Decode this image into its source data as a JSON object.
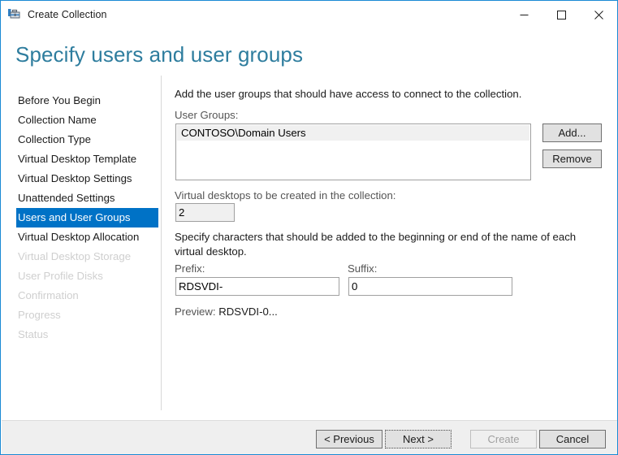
{
  "window": {
    "title": "Create Collection",
    "icon": "collection-toolbox-icon",
    "controls": {
      "minimize": "minimize-icon",
      "maximize": "maximize-icon",
      "close": "close-icon"
    },
    "accent_border": "#1a8ad4"
  },
  "header": {
    "page_title": "Specify users and user groups",
    "title_color": "#2e7d9e"
  },
  "sidebar": {
    "selected_color": "#0072c6",
    "items": [
      {
        "label": "Before You Begin",
        "state": "normal"
      },
      {
        "label": "Collection Name",
        "state": "normal"
      },
      {
        "label": "Collection Type",
        "state": "normal"
      },
      {
        "label": "Virtual Desktop Template",
        "state": "normal"
      },
      {
        "label": "Virtual Desktop Settings",
        "state": "normal"
      },
      {
        "label": "Unattended Settings",
        "state": "normal"
      },
      {
        "label": "Users and User Groups",
        "state": "selected"
      },
      {
        "label": "Virtual Desktop Allocation",
        "state": "normal"
      },
      {
        "label": "Virtual Desktop Storage",
        "state": "disabled"
      },
      {
        "label": "User Profile Disks",
        "state": "disabled"
      },
      {
        "label": "Confirmation",
        "state": "disabled"
      },
      {
        "label": "Progress",
        "state": "disabled"
      },
      {
        "label": "Status",
        "state": "disabled"
      }
    ]
  },
  "main": {
    "intro_text": "Add the user groups that should have access to connect to the collection.",
    "user_groups": {
      "label": "User Groups:",
      "entries": [
        "CONTOSO\\Domain Users"
      ],
      "add_button": "Add...",
      "remove_button": "Remove"
    },
    "desktop_count": {
      "label": "Virtual desktops to be created in the collection:",
      "value": "2"
    },
    "naming": {
      "description": "Specify characters that should be added to the beginning or end of the name of each virtual desktop.",
      "prefix_label": "Prefix:",
      "prefix_value": "RDSVDI-",
      "suffix_label": "Suffix:",
      "suffix_value": "0",
      "preview_label": "Preview:",
      "preview_value": "RDSVDI-0..."
    }
  },
  "footer": {
    "previous": "< Previous",
    "next": "Next >",
    "create": "Create",
    "cancel": "Cancel"
  }
}
